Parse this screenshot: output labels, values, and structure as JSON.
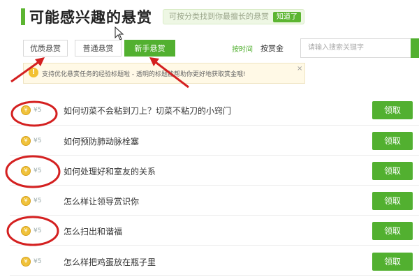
{
  "header": {
    "title": "可能感兴趣的悬赏",
    "hint": "可按分类找到你最擅长的悬赏",
    "hint_button": "知道了"
  },
  "tabs": [
    {
      "label": "优质悬赏",
      "active": false
    },
    {
      "label": "普通悬赏",
      "active": false
    },
    {
      "label": "新手悬赏",
      "active": true
    }
  ],
  "sort": {
    "by_time": "按时间",
    "by_reward": "按赏金"
  },
  "search": {
    "placeholder": "请输入搜索关键字"
  },
  "tip": {
    "icon": "info-icon",
    "text": "支持优化悬赏任务的经验标题啦 - 透明的标题能帮助你更好地获取赏金哦!",
    "close": "×"
  },
  "questions": [
    {
      "reward": "¥5",
      "text": "如何切菜不会粘到刀上？切菜不粘刀的小窍门",
      "button": "领取"
    },
    {
      "reward": "¥5",
      "text": "如何预防肺动脉栓塞",
      "button": "领取"
    },
    {
      "reward": "¥5",
      "text": "如何处理好和室友的关系",
      "button": "领取"
    },
    {
      "reward": "¥5",
      "text": "怎么样让领导赏识你",
      "button": "领取"
    },
    {
      "reward": "¥5",
      "text": "怎么扫出和谐福",
      "button": "领取"
    },
    {
      "reward": "¥5",
      "text": "怎么样把鸡蛋放在瓶子里",
      "button": "领取"
    }
  ],
  "colors": {
    "accent": "#52b030",
    "annotation": "#d42020",
    "coin": "#f0c23a"
  }
}
